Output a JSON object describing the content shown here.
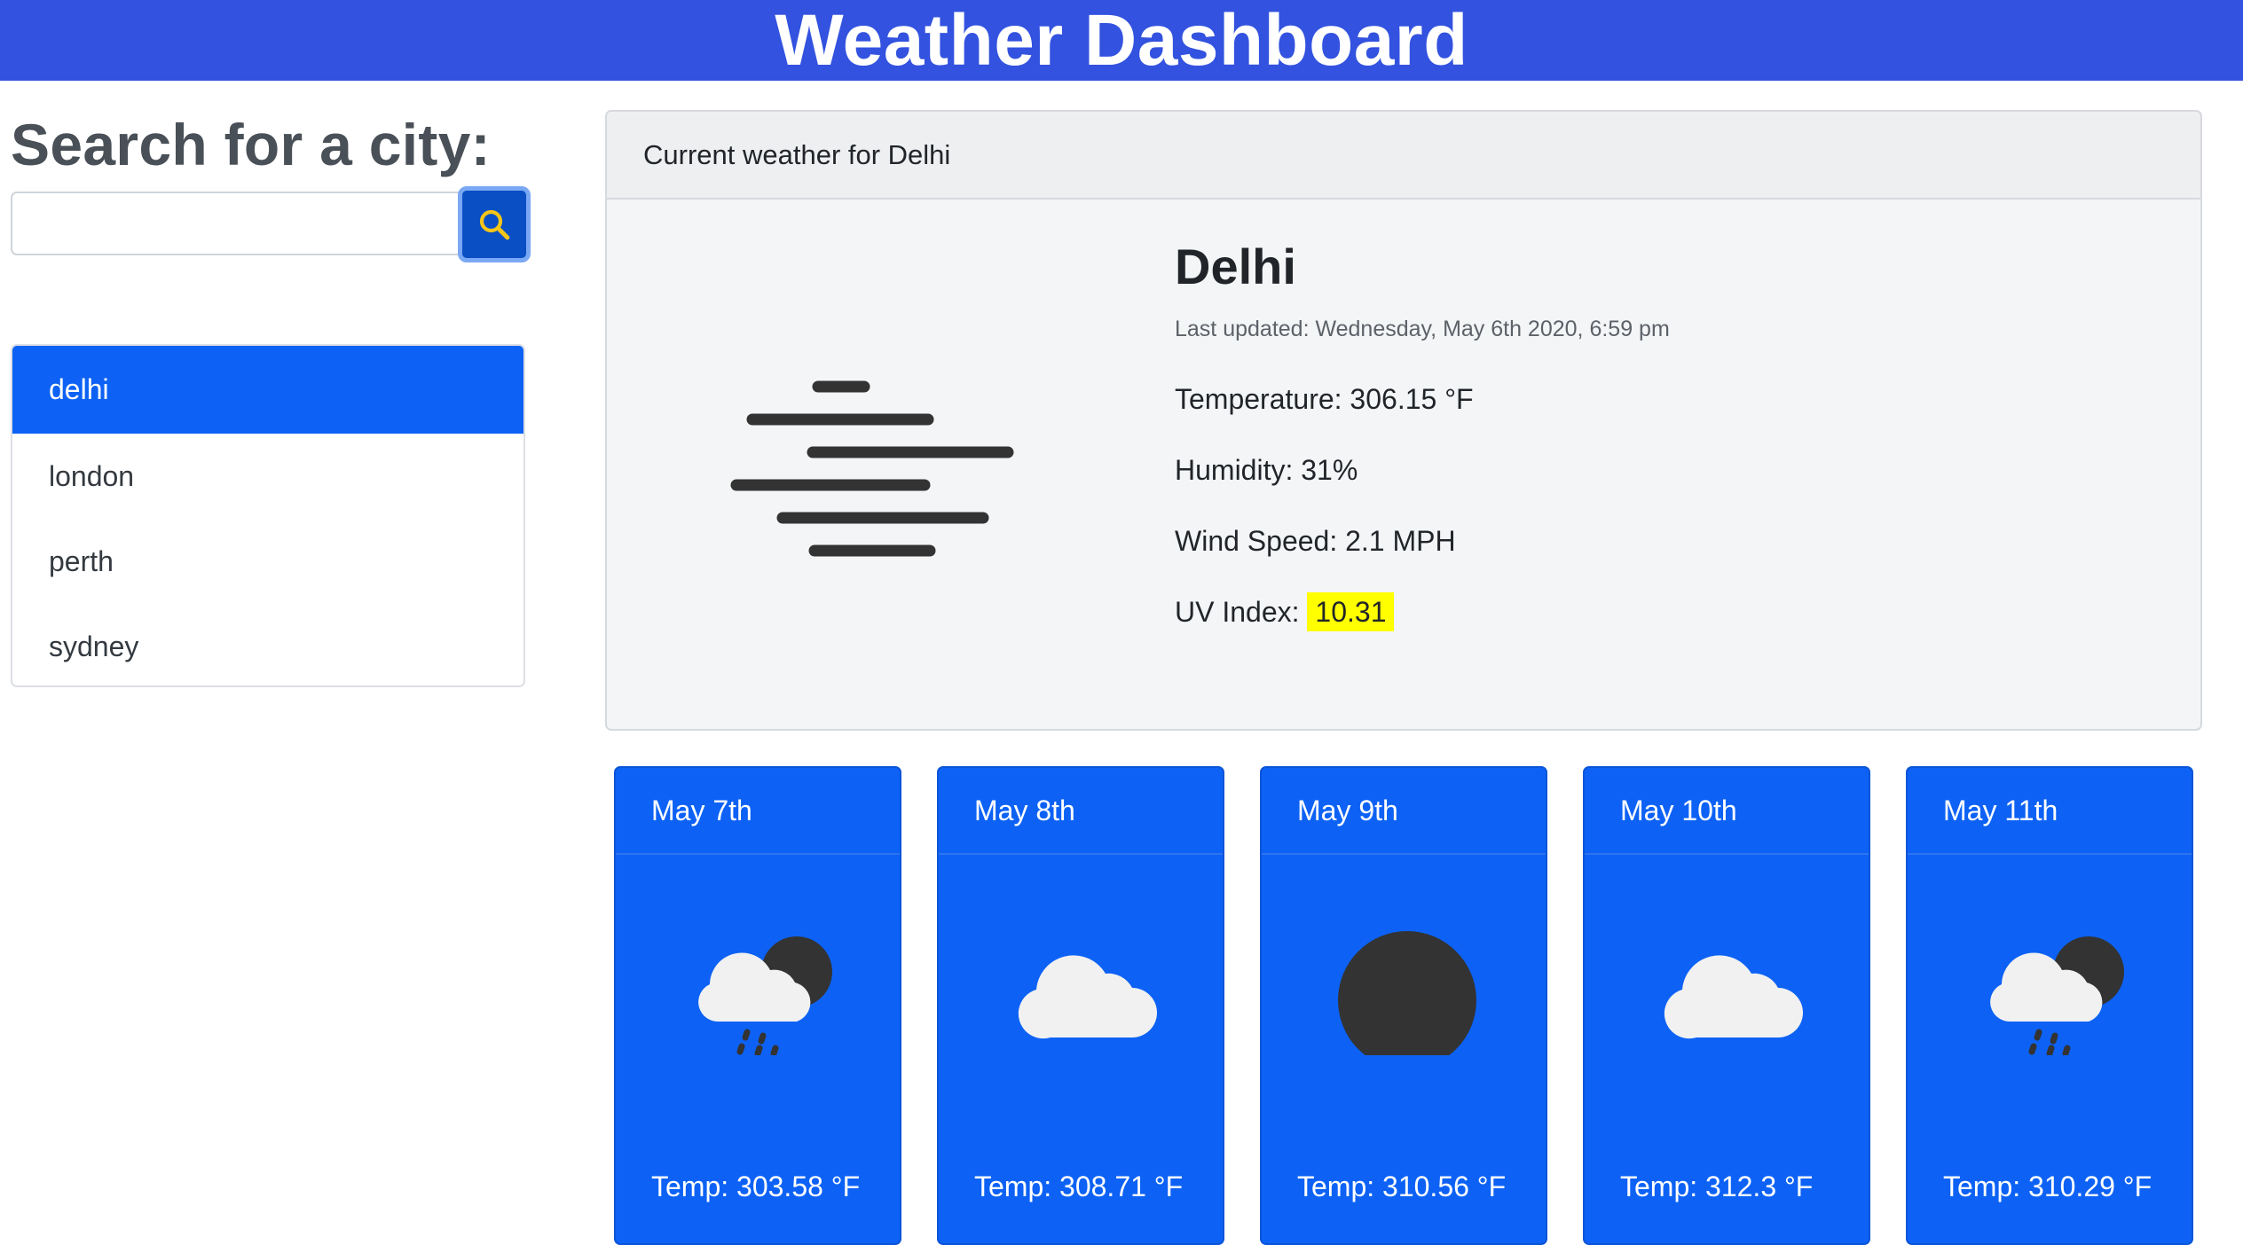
{
  "header": {
    "title": "Weather Dashboard"
  },
  "search": {
    "title": "Search for a city:",
    "value": "",
    "placeholder": "",
    "button_icon": "search-icon"
  },
  "cities": [
    {
      "label": "delhi",
      "active": true
    },
    {
      "label": "london",
      "active": false
    },
    {
      "label": "perth",
      "active": false
    },
    {
      "label": "sydney",
      "active": false
    }
  ],
  "current": {
    "header": "Current weather for Delhi",
    "icon": "fog-icon",
    "city": "Delhi",
    "last_updated": "Last updated: Wednesday, May 6th 2020, 6:59 pm",
    "temperature": "Temperature: 306.15 °F",
    "humidity": "Humidity: 31%",
    "wind": "Wind Speed: 2.1 MPH",
    "uv_label": "UV Index:",
    "uv_value": "10.31"
  },
  "forecast": [
    {
      "date": "May 7th",
      "icon": "night-rain-icon",
      "temp": "Temp: 303.58 °F"
    },
    {
      "date": "May 8th",
      "icon": "cloud-icon",
      "temp": "Temp: 308.71 °F"
    },
    {
      "date": "May 9th",
      "icon": "clear-night-icon",
      "temp": "Temp: 310.56 °F"
    },
    {
      "date": "May 10th",
      "icon": "cloud-icon",
      "temp": "Temp: 312.3 °F"
    },
    {
      "date": "May 11th",
      "icon": "night-rain-icon",
      "temp": "Temp: 310.29 °F"
    }
  ],
  "colors": {
    "header_bg": "#3252df",
    "accent": "#0d62f5",
    "uv_highlight": "#ffff00",
    "search_icon": "#f5c518"
  }
}
